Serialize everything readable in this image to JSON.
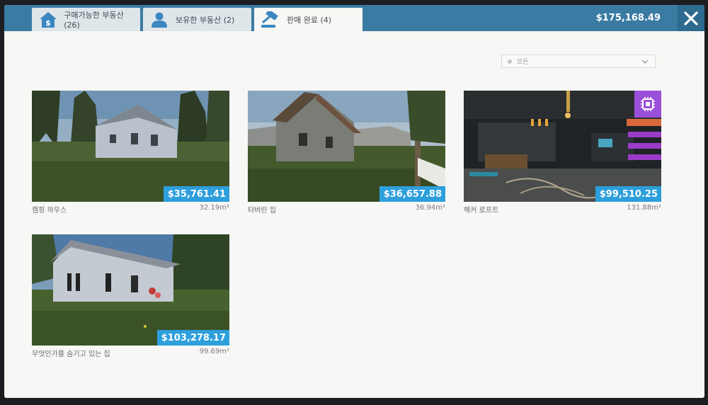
{
  "tabs": [
    {
      "label": "구매가능한 부동산 (26)",
      "icon": "house-dollar-icon"
    },
    {
      "label": "보유한 부동산 (2)",
      "icon": "user-icon"
    },
    {
      "label": "판매 완료 (4)",
      "icon": "gavel-icon"
    }
  ],
  "balance": "$175,168.49",
  "filter": {
    "selected": "모든"
  },
  "properties": [
    {
      "name": "캠핑 하우스",
      "price": "$35,761.41",
      "area": "32.19",
      "area_unit": "m²"
    },
    {
      "name": "타버린 집",
      "price": "$36,657.88",
      "area": "36.94",
      "area_unit": "m²"
    },
    {
      "name": "해커 로프트",
      "price": "$99,510.25",
      "area": "131.88",
      "area_unit": "m²"
    },
    {
      "name": "무엇인가를 숨기고 있는 집",
      "price": "$103,278.17",
      "area": "99.69",
      "area_unit": "m²"
    }
  ],
  "colors": {
    "topbar": "#3a7ba3",
    "accent": "#2d9fdc",
    "badge": "#9a4fd8"
  }
}
